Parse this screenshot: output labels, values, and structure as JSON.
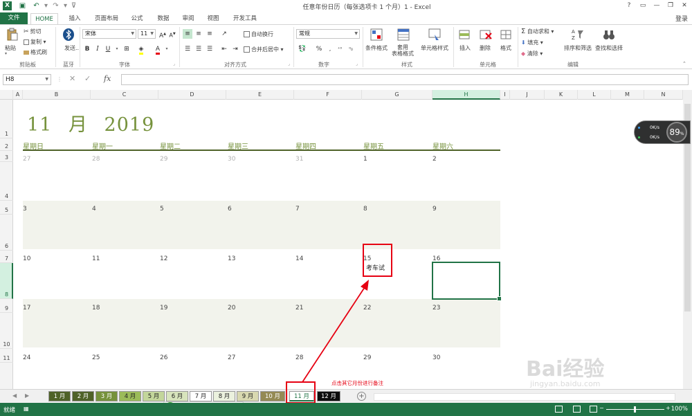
{
  "window": {
    "title": "任意年份日历（每张选项卡 1 个月）1 - Excel",
    "help": "?",
    "signin": "登录"
  },
  "ribbon_tabs": [
    "文件",
    "HOME",
    "插入",
    "页面布局",
    "公式",
    "数据",
    "审阅",
    "视图",
    "开发工具"
  ],
  "ribbon": {
    "clipboard": {
      "label": "剪贴板",
      "paste": "粘贴",
      "cut": "剪切",
      "copy": "复制",
      "painter": "格式刷"
    },
    "bluetooth": {
      "label": "蓝牙",
      "send": "发送..."
    },
    "font": {
      "label": "字体",
      "name": "宋体",
      "size": "11"
    },
    "alignment": {
      "label": "对齐方式",
      "wrap": "自动换行",
      "merge": "合并后居中"
    },
    "number": {
      "label": "数字",
      "format": "常规"
    },
    "styles": {
      "label": "样式",
      "conditional": "条件格式",
      "table": "套用\n表格格式",
      "cell": "单元格样式"
    },
    "cells": {
      "label": "单元格",
      "insert": "插入",
      "delete": "删除",
      "format": "格式"
    },
    "editing": {
      "label": "编辑",
      "autosum": "自动求和",
      "fill": "填充",
      "clear": "清除",
      "sort": "排序和筛选",
      "find": "查找和选择"
    }
  },
  "formula_bar": {
    "name_box": "H8",
    "fx": "fx",
    "value": ""
  },
  "columns": [
    "A",
    "B",
    "C",
    "D",
    "E",
    "F",
    "G",
    "H",
    "I",
    "J",
    "K",
    "L",
    "M",
    "N"
  ],
  "selected_column": "H",
  "rows": [
    "1",
    "2",
    "3",
    "4",
    "5",
    "6",
    "7",
    "8",
    "9",
    "10",
    "11"
  ],
  "selected_row": "8",
  "calendar": {
    "month": "11",
    "month_unit": "月",
    "year": "2019",
    "weekdays": [
      "星期日",
      "星期一",
      "星期二",
      "星期三",
      "星期四",
      "星期五",
      "星期六"
    ],
    "weeks": [
      [
        "27",
        "28",
        "29",
        "30",
        "31",
        "1",
        "2"
      ],
      [
        "3",
        "4",
        "5",
        "6",
        "7",
        "8",
        "9"
      ],
      [
        "10",
        "11",
        "12",
        "13",
        "14",
        "15",
        "16"
      ],
      [
        "17",
        "18",
        "19",
        "20",
        "21",
        "22",
        "23"
      ],
      [
        "24",
        "25",
        "26",
        "27",
        "28",
        "29",
        "30"
      ]
    ],
    "note_15": "考车试"
  },
  "annotation": "点击其它月份进行备注",
  "net_widget": {
    "up": "0K/s",
    "down": "0K/s",
    "percent": "89",
    "unit": "%"
  },
  "sheet_tabs": [
    "1 月",
    "2 月",
    "3 月",
    "4 月",
    "5 月",
    "6 月",
    "7 月",
    "8 月",
    "9 月",
    "10 月",
    "11 月",
    "12 月"
  ],
  "active_sheet": "11 月",
  "sheet_tab_colors": [
    "#4f6228",
    "#4f6228",
    "#76923c",
    "#9bbb59",
    "#c3d69b",
    "#d7e4bc",
    "#ffffff",
    "#ebf1de",
    "#d8d8b0",
    "#948a54",
    "#ffffff",
    "#0d0d0d"
  ],
  "ime": {
    "logo": "S",
    "mode": "五",
    "moon": "☽",
    "punct": "•,",
    "keyboard": "⌨",
    "user": "☺",
    "tool": "✎"
  },
  "status": {
    "ready": "就绪",
    "zoom": "100%"
  },
  "watermark": {
    "brand": "Bai经验",
    "url": "jingyan.baidu.com"
  },
  "colors": {
    "excel_green": "#217346",
    "calendar_green": "#76923c",
    "band": "#f2f3ec",
    "annot_red": "#e60012"
  }
}
